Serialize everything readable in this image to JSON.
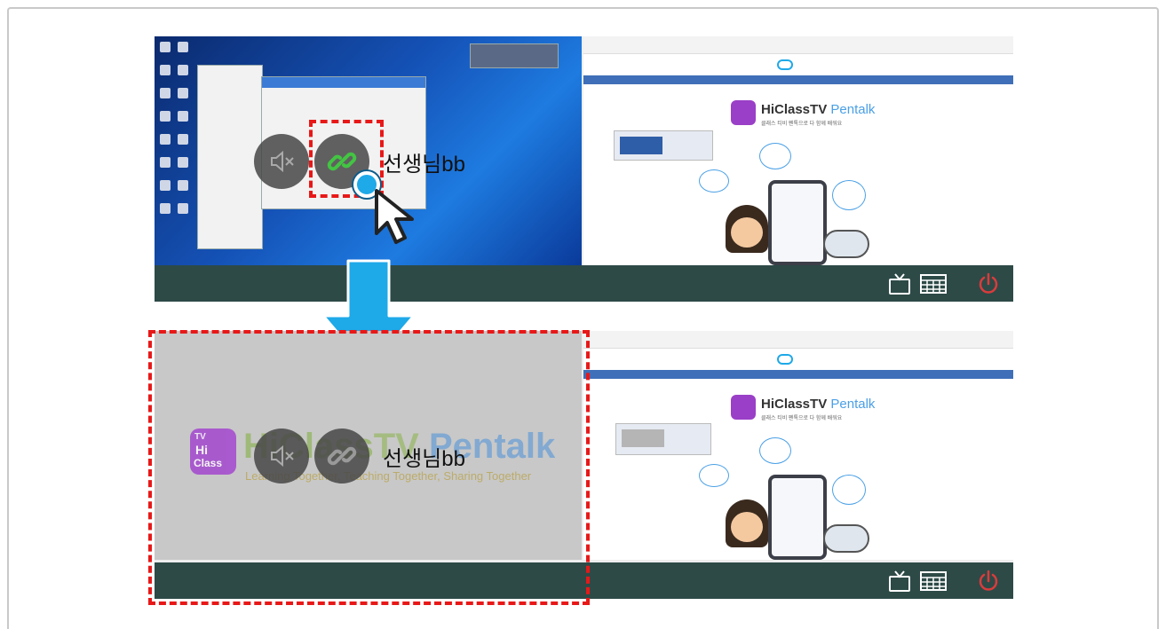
{
  "name_label": "선생님bb",
  "right_screen": {
    "brand_main": "HiClassTV",
    "brand_accent": "Pentalk",
    "slogan": "클래스 티비 펜톡으로 다 함께 배워요"
  },
  "watermark": {
    "logo_tv": "TV",
    "logo_hi": "Hi",
    "logo_class": "Class",
    "title_main": "HiClass",
    "title_tv": "TV",
    "title_pentalk": "Pentalk",
    "tagline": "Learning Together, Teaching Together, Sharing Together"
  },
  "icons": [
    "mute-icon",
    "link-icon",
    "tv-icon",
    "keyboard-icon",
    "power-icon",
    "arrow-down-icon",
    "cursor-icon"
  ],
  "colors": {
    "highlight": "#e81818",
    "arrow": "#1ea9e8",
    "bar": "#2d4a47",
    "power": "#d93c3c",
    "link_active": "#43c443",
    "gray_screen": "#c8c8c8"
  }
}
